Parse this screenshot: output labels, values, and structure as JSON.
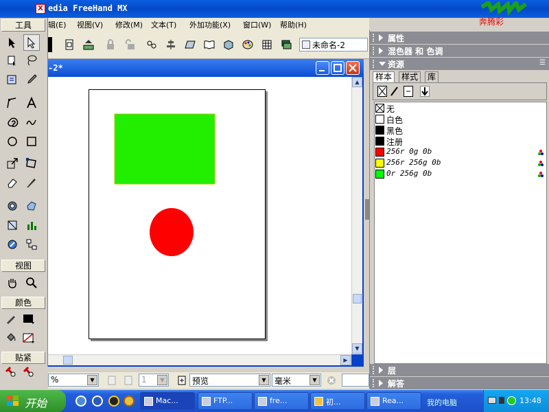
{
  "app": {
    "title": "edia FreeHand MX",
    "logo_text": "奔腾彩"
  },
  "menu": {
    "items": [
      "辑(E)",
      "视图(V)",
      "修改(M)",
      "文本(T)",
      "外加功能(X)",
      "窗口(W)",
      "帮助(H)"
    ]
  },
  "tools": {
    "header": "工具",
    "view_header": "视图",
    "color_header": "颜色",
    "snap_header": "贴紧"
  },
  "toolbar": {
    "document_select": "未命名-2"
  },
  "document": {
    "title": "-2*"
  },
  "status": {
    "zoom": "%",
    "page": "1",
    "view_mode": "预览",
    "units": "毫米"
  },
  "panels": {
    "properties": "属性",
    "mixer": "混色器 和 色调",
    "assets": "资源",
    "layers": "层",
    "answers": "解答",
    "tabs": [
      "样本",
      "样式",
      "库"
    ]
  },
  "swatches": [
    {
      "name": "无",
      "color": "none",
      "italic": false,
      "rgb": false
    },
    {
      "name": "白色",
      "color": "#ffffff",
      "italic": false,
      "rgb": false
    },
    {
      "name": "黑色",
      "color": "#000000",
      "italic": false,
      "rgb": false
    },
    {
      "name": "注册",
      "color": "#000000",
      "italic": false,
      "rgb": false
    },
    {
      "name": "256r 0g 0b",
      "color": "#ff0000",
      "italic": true,
      "rgb": true
    },
    {
      "name": "256r 256g 0b",
      "color": "#ffff00",
      "italic": true,
      "rgb": true
    },
    {
      "name": "0r 256g 0b",
      "color": "#00ff00",
      "italic": true,
      "rgb": true
    }
  ],
  "canvas_shapes": {
    "rect_color": "#22ee00",
    "circle_color": "#ff0000"
  },
  "taskbar": {
    "start": "开始",
    "tasks": [
      "Mac...",
      "FTP...",
      "fre...",
      "初...",
      "Rea..."
    ],
    "desktop": "我的电脑",
    "clock": "13:48"
  }
}
